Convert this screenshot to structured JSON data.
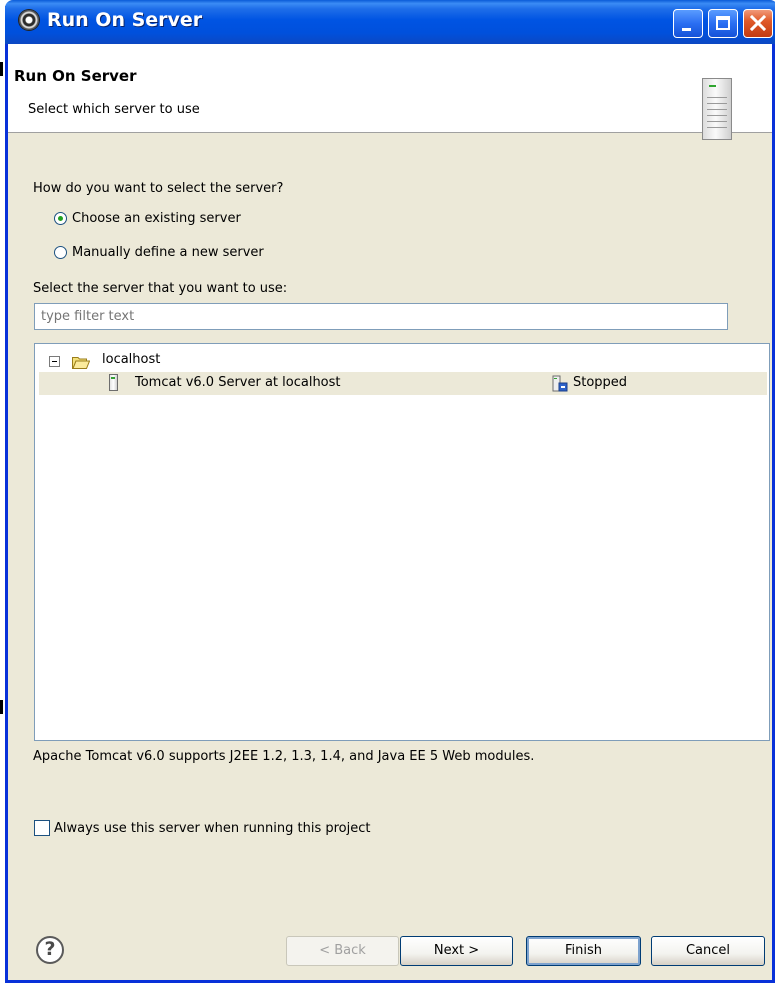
{
  "window": {
    "title": "Run On Server"
  },
  "header": {
    "title": "Run On Server",
    "description": "Select which server to use"
  },
  "selection": {
    "question": "How do you want to select the server?",
    "options": [
      {
        "label": "Choose an existing server",
        "checked": true
      },
      {
        "label": "Manually define a new server",
        "checked": false
      }
    ],
    "list_label": "Select the server that you want to use:",
    "filter_placeholder": "type filter text"
  },
  "tree": {
    "host": "localhost",
    "servers": [
      {
        "name": "Tomcat v6.0 Server at localhost",
        "status": "Stopped",
        "selected": true
      }
    ]
  },
  "info": "Apache Tomcat v6.0 supports J2EE 1.2, 1.3, 1.4, and Java EE 5 Web modules.",
  "always_use": {
    "label": "Always use this server when running this project",
    "checked": false
  },
  "buttons": {
    "help": "?",
    "back": "< Back",
    "next": "Next >",
    "finish": "Finish",
    "cancel": "Cancel"
  }
}
